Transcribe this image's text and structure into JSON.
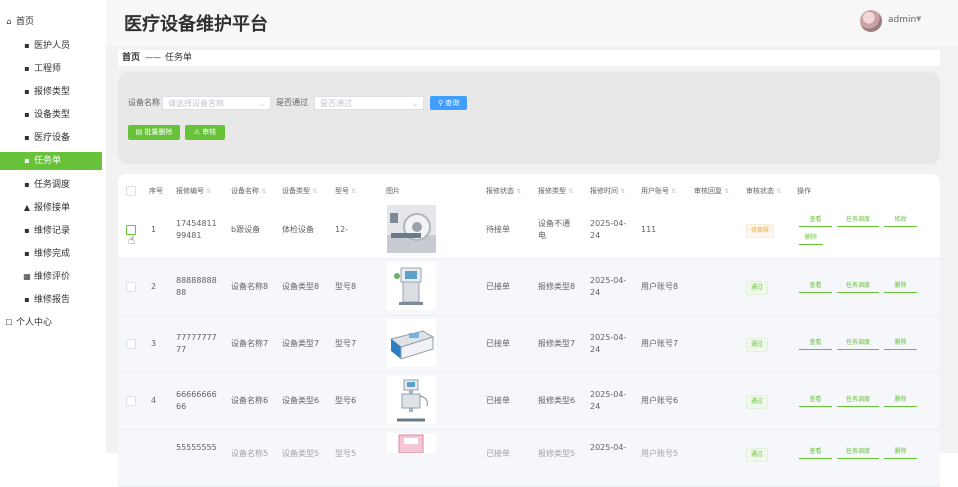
{
  "sidebar": {
    "items": [
      {
        "label": "首页",
        "icon": "home-icon",
        "glyph": "⌂"
      },
      {
        "label": "医护人员",
        "icon": "grid-icon",
        "glyph": "▪"
      },
      {
        "label": "工程师",
        "icon": "grid-icon",
        "glyph": "▪"
      },
      {
        "label": "报修类型",
        "icon": "grid-icon",
        "glyph": "▪"
      },
      {
        "label": "设备类型",
        "icon": "doc-icon",
        "glyph": "▪"
      },
      {
        "label": "医疗设备",
        "icon": "grid-icon",
        "glyph": "▪"
      },
      {
        "label": "任务单",
        "icon": "grid-icon",
        "glyph": "▪"
      },
      {
        "label": "任务调度",
        "icon": "edit-icon",
        "glyph": "▪"
      },
      {
        "label": "报修接单",
        "icon": "user-icon",
        "glyph": "▲"
      },
      {
        "label": "维修记录",
        "icon": "monitor-icon",
        "glyph": "▪"
      },
      {
        "label": "维修完成",
        "icon": "thumb-icon",
        "glyph": "▪"
      },
      {
        "label": "维修评价",
        "icon": "table-icon",
        "glyph": "▦"
      },
      {
        "label": "维修报告",
        "icon": "grid-icon",
        "glyph": "▪"
      },
      {
        "label": "个人中心",
        "icon": "person-icon",
        "glyph": "☐"
      }
    ],
    "active_index": 6
  },
  "header": {
    "title": "医疗设备维护平台",
    "user": "admin",
    "caret": "▼"
  },
  "breadcrumb": {
    "home": "首页",
    "separator": "——",
    "current": "任务单"
  },
  "search": {
    "device_label": "设备名称",
    "device_placeholder": "请选择设备名称",
    "pass_label": "是否通过",
    "pass_placeholder": "是否通过",
    "search_button": "查询",
    "batch_delete": "批量删除",
    "audit": "审核"
  },
  "table": {
    "headers": [
      "序号",
      "报修编号",
      "设备名称",
      "设备类型",
      "型号",
      "图片",
      "报修状态",
      "报修类型",
      "报修时间",
      "用户账号",
      "审核回复",
      "审核状态",
      "操作"
    ],
    "rows": [
      {
        "index": "1",
        "code": [
          "17454811",
          "99481"
        ],
        "device": "b跟设备",
        "type": "体检设备",
        "model": "12-",
        "status": "待接单",
        "repair_type": [
          "设备不通",
          "电"
        ],
        "time": [
          "2025-04-",
          "24"
        ],
        "account": "111",
        "audit": "待审核",
        "ops": [
          "查看",
          "任务调度",
          "修改",
          "删除"
        ]
      },
      {
        "index": "2",
        "code": [
          "88888888",
          "88"
        ],
        "device": "设备名称8",
        "type": "设备类型8",
        "model": "型号8",
        "status": "已接单",
        "repair_type": [
          "报修类型8"
        ],
        "time": [
          "2025-04-",
          "24"
        ],
        "account": "用户账号8",
        "audit": "通过",
        "ops": [
          "查看",
          "任务调度",
          "删除"
        ]
      },
      {
        "index": "3",
        "code": [
          "77777777",
          "77"
        ],
        "device": "设备名称7",
        "type": "设备类型7",
        "model": "型号7",
        "status": "已接单",
        "repair_type": [
          "报修类型7"
        ],
        "time": [
          "2025-04-",
          "24"
        ],
        "account": "用户账号7",
        "audit": "通过",
        "ops": [
          "查看",
          "任务调度",
          "删除"
        ]
      },
      {
        "index": "4",
        "code": [
          "66666666",
          "66"
        ],
        "device": "设备名称6",
        "type": "设备类型6",
        "model": "型号6",
        "status": "已接单",
        "repair_type": [
          "报修类型6"
        ],
        "time": [
          "2025-04-",
          "24"
        ],
        "account": "用户账号6",
        "audit": "通过",
        "ops": [
          "查看",
          "任务调度",
          "删除"
        ]
      },
      {
        "index": "5",
        "code": [
          "55555555"
        ],
        "device": "设备名称5",
        "type": "设备类型5",
        "model": "型号5",
        "status": "已接单",
        "repair_type": [
          "报修类型5"
        ],
        "time": [
          "2025-04-"
        ],
        "account": "用户账号5",
        "audit": "通过",
        "ops": [
          "查看",
          "任务调度",
          "删除"
        ]
      }
    ]
  },
  "colors": {
    "accent": "#67c23a",
    "primary": "#409eff",
    "warning": "#e6a23c"
  }
}
